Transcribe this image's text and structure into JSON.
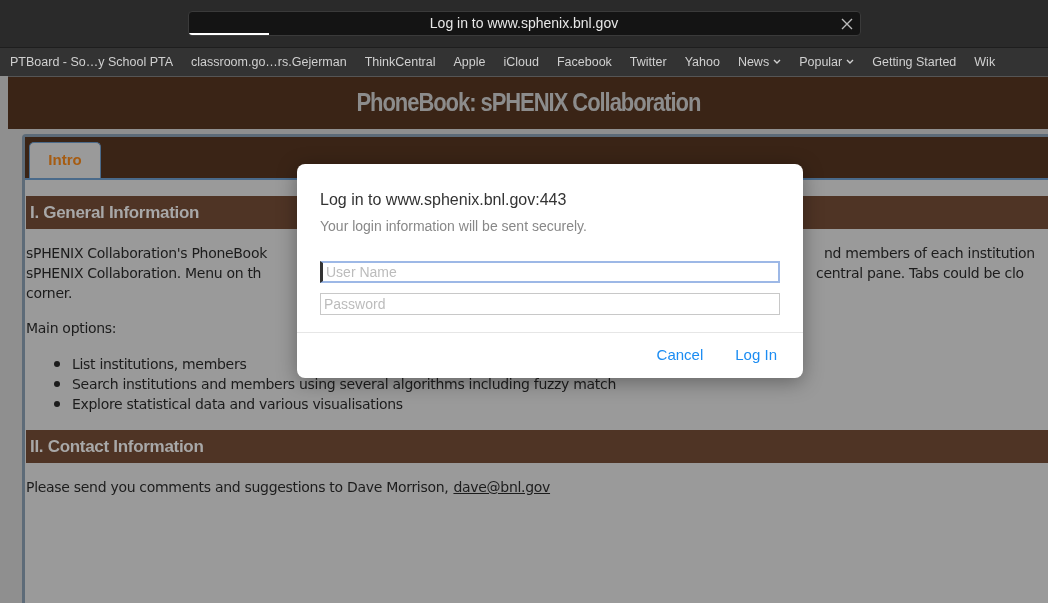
{
  "browser": {
    "address_title": "Log in to www.sphenix.bnl.gov",
    "level": 0.12,
    "bookmarks": [
      {
        "label": "PTBoard - So…y School PTA",
        "kind": "link"
      },
      {
        "label": "classroom.go…rs.Gejerman",
        "kind": "link"
      },
      {
        "label": "ThinkCentral",
        "kind": "link"
      },
      {
        "label": "Apple",
        "kind": "link"
      },
      {
        "label": "iCloud",
        "kind": "link"
      },
      {
        "label": "Facebook",
        "kind": "link"
      },
      {
        "label": "Twitter",
        "kind": "link"
      },
      {
        "label": "Yahoo",
        "kind": "link"
      },
      {
        "label": "News",
        "kind": "menu"
      },
      {
        "label": "Popular",
        "kind": "menu"
      },
      {
        "label": "Getting Started",
        "kind": "link"
      },
      {
        "label": "Wik",
        "kind": "link"
      }
    ]
  },
  "page": {
    "title": "PhoneBook: sPHENIX Collaboration",
    "tabs": [
      {
        "label": "Intro",
        "selected": true
      }
    ],
    "general": {
      "heading": "I. General Information",
      "lines": [
        {
          "left": "sPHENIX Collaboration's PhoneBook",
          "right": "nd members of each institution"
        },
        {
          "left": "sPHENIX Collaboration. Menu on th",
          "right": "central pane. Tabs could be clo"
        },
        {
          "left": "corner."
        }
      ],
      "options_label": "Main options:",
      "options": [
        "List institutions, members",
        "Search institutions and members using several algorithms including fuzzy match",
        "Explore statistical data and various visualisations"
      ]
    },
    "contact": {
      "heading": "II. Contact Information",
      "text": "Please send you comments and suggestions to Dave Morrison,",
      "link": "dave@bnl.gov"
    }
  },
  "dialog": {
    "title": "Log in to www.sphenix.bnl.gov:443",
    "subtitle": "Your login information will be sent securely.",
    "fields": [
      {
        "placeholder": "User Name",
        "focused": true
      },
      {
        "placeholder": "Password",
        "focused": false
      }
    ],
    "buttons": [
      "Cancel",
      "Log In"
    ]
  }
}
